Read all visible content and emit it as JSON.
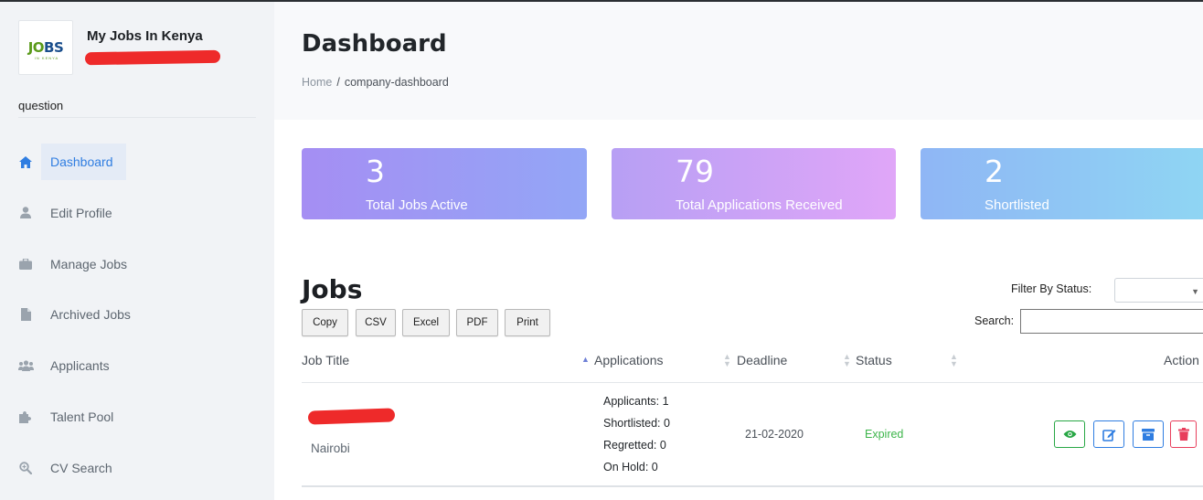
{
  "sidebar": {
    "logo": {
      "text_primary": "J",
      "text_middle": "O",
      "text_secondary": "BS",
      "tagline": "IN KENYA"
    },
    "company_name": "My Jobs In Kenya",
    "user_role": "question",
    "items": [
      {
        "label": "Dashboard",
        "icon": "home-icon",
        "active": true
      },
      {
        "label": "Edit Profile",
        "icon": "user-icon",
        "active": false
      },
      {
        "label": "Manage Jobs",
        "icon": "briefcase-icon",
        "active": false
      },
      {
        "label": "Archived Jobs",
        "icon": "file-icon",
        "active": false
      },
      {
        "label": "Applicants",
        "icon": "users-icon",
        "active": false
      },
      {
        "label": "Talent Pool",
        "icon": "puzzle-icon",
        "active": false
      },
      {
        "label": "CV Search",
        "icon": "search-icon",
        "active": false
      }
    ]
  },
  "header": {
    "title": "Dashboard",
    "breadcrumb": {
      "home": "Home",
      "separator": "/",
      "current": "company-dashboard"
    }
  },
  "stats": [
    {
      "value": "3",
      "label": "Total Jobs Active"
    },
    {
      "value": "79",
      "label": "Total Applications Received"
    },
    {
      "value": "2",
      "label": "Shortlisted"
    }
  ],
  "jobs": {
    "title": "Jobs",
    "export_buttons": {
      "copy": "Copy",
      "csv": "CSV",
      "excel": "Excel",
      "pdf": "PDF",
      "print": "Print"
    },
    "filter_label": "Filter By Status:",
    "filter_value": "",
    "search_label": "Search:",
    "search_value": "",
    "columns": {
      "job_title": "Job Title",
      "applications": "Applications",
      "deadline": "Deadline",
      "status": "Status",
      "action": "Action"
    },
    "rows": [
      {
        "location": "Nairobi",
        "applicants": "Applicants: 1",
        "shortlisted": "Shortlisted: 0",
        "regretted": "Regretted: 0",
        "on_hold": "On Hold: 0",
        "deadline": "21-02-2020",
        "status": "Expired"
      }
    ]
  },
  "colors": {
    "accent": "#2f7de1",
    "status_expired": "#3cb54a",
    "view": "#28a745",
    "delete": "#e83e5c"
  }
}
